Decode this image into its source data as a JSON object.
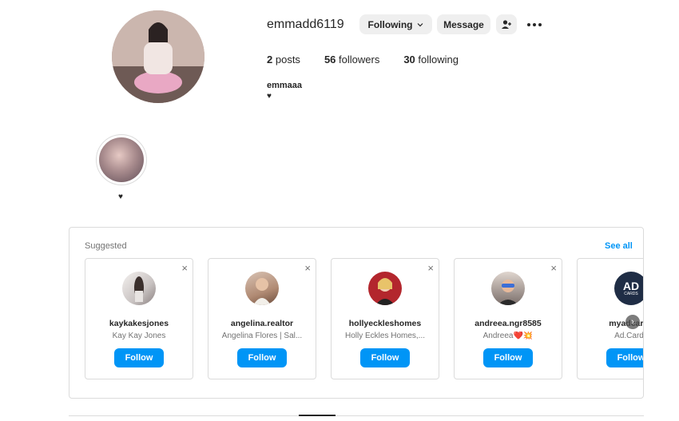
{
  "profile": {
    "username": "emmadd6119",
    "following_label": "Following",
    "message_label": "Message",
    "posts_count": "2",
    "posts_label": "posts",
    "followers_count": "56",
    "followers_label": "followers",
    "following_count": "30",
    "following_stat_label": "following",
    "full_name": "emmaaa",
    "bio": "♥"
  },
  "highlight": {
    "label": "♥"
  },
  "suggested": {
    "title": "Suggested",
    "see_all": "See all",
    "cards": [
      {
        "username": "kaykakesjones",
        "subtitle": "Kay Kay Jones",
        "follow": "Follow",
        "close": "×"
      },
      {
        "username": "angelina.realtor",
        "subtitle": "Angelina Flores | Sal...",
        "follow": "Follow",
        "close": "×"
      },
      {
        "username": "hollyeckleshomes",
        "subtitle": "Holly Eckles Homes,...",
        "follow": "Follow",
        "close": "×"
      },
      {
        "username": "andreea.ngr8585",
        "subtitle": "Andreea❤️💥",
        "follow": "Follow",
        "close": "×"
      },
      {
        "username": "myadcards",
        "subtitle": "Ad.Cards",
        "follow": "Follow",
        "close": "×",
        "logo_text": "AD",
        "logo_sub": "CARDS"
      }
    ]
  },
  "colors": {
    "accent": "#0095f6",
    "border": "#dbdbdb",
    "muted": "#737373"
  }
}
